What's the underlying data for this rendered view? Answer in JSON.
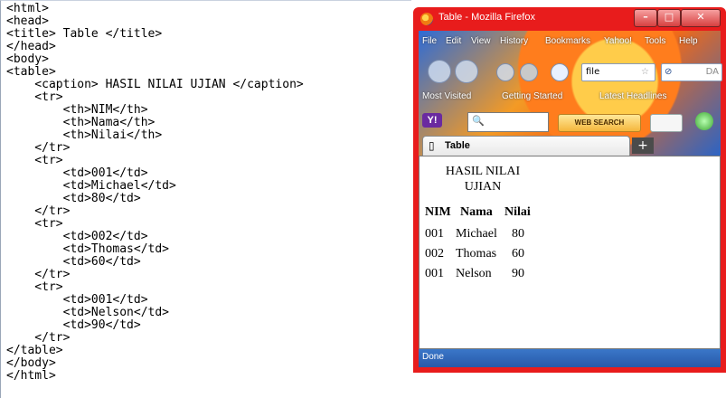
{
  "code": {
    "lines": [
      "<html>",
      "<head>",
      "<title> Table </title>",
      "</head>",
      "<body>",
      "<table>",
      "    <caption> HASIL NILAI UJIAN </caption>",
      "    <tr>",
      "        <th>NIM</th>",
      "        <th>Nama</th>",
      "        <th>Nilai</th>",
      "    </tr>",
      "    <tr>",
      "        <td>001</td>",
      "        <td>Michael</td>",
      "        <td>80</td>",
      "    </tr>",
      "    <tr>",
      "        <td>002</td>",
      "        <td>Thomas</td>",
      "        <td>60</td>",
      "    </tr>",
      "    <tr>",
      "        <td>001</td>",
      "        <td>Nelson</td>",
      "        <td>90</td>",
      "    </tr>",
      "</table>",
      "</body>",
      "</html>"
    ]
  },
  "browser": {
    "window_title": "Table - Mozilla Firefox",
    "menu": [
      "File",
      "Edit",
      "View",
      "History",
      "Bookmarks",
      "Yahoo!",
      "Tools",
      "Help"
    ],
    "url": "file",
    "search_placeholder": "DA",
    "bookmarks": [
      "Most Visited",
      "Getting Started",
      "Latest Headlines"
    ],
    "yahoo_search_button": "WEB SEARCH",
    "yahoo_logo": "Y!",
    "tab_title": "Table",
    "status": "Done",
    "colors": {
      "frame": "#e81c1c",
      "status": "#2859a8"
    }
  },
  "table": {
    "caption_line1": "HASIL NILAI",
    "caption_line2": "UJIAN",
    "headers": [
      "NIM",
      "Nama",
      "Nilai"
    ],
    "rows": [
      [
        "001",
        "Michael",
        "80"
      ],
      [
        "002",
        "Thomas",
        "60"
      ],
      [
        "001",
        "Nelson",
        "90"
      ]
    ]
  }
}
